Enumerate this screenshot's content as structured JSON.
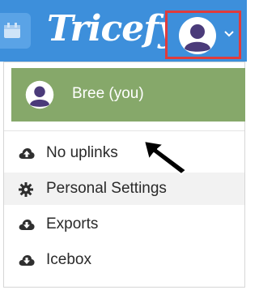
{
  "header": {
    "logo_text": "Tricefy",
    "calendar_icon": "calendar-icon",
    "profile_icon": "user-avatar-icon",
    "profile_chevron": "chevron-down-icon",
    "brand_color": "#3d8fdb",
    "highlight_border_color": "#e03b3b"
  },
  "dropdown": {
    "user": {
      "name": "Bree (you)",
      "background_color": "#86a86a",
      "icon": "user-avatar-icon"
    },
    "items": [
      {
        "label": "No uplinks",
        "icon": "cloud-upload-icon",
        "highlighted": false
      },
      {
        "label": "Personal Settings",
        "icon": "gear-icon",
        "highlighted": true
      },
      {
        "label": "Exports",
        "icon": "cloud-download-icon",
        "highlighted": false
      },
      {
        "label": "Icebox",
        "icon": "cloud-download-icon",
        "highlighted": false
      }
    ]
  }
}
